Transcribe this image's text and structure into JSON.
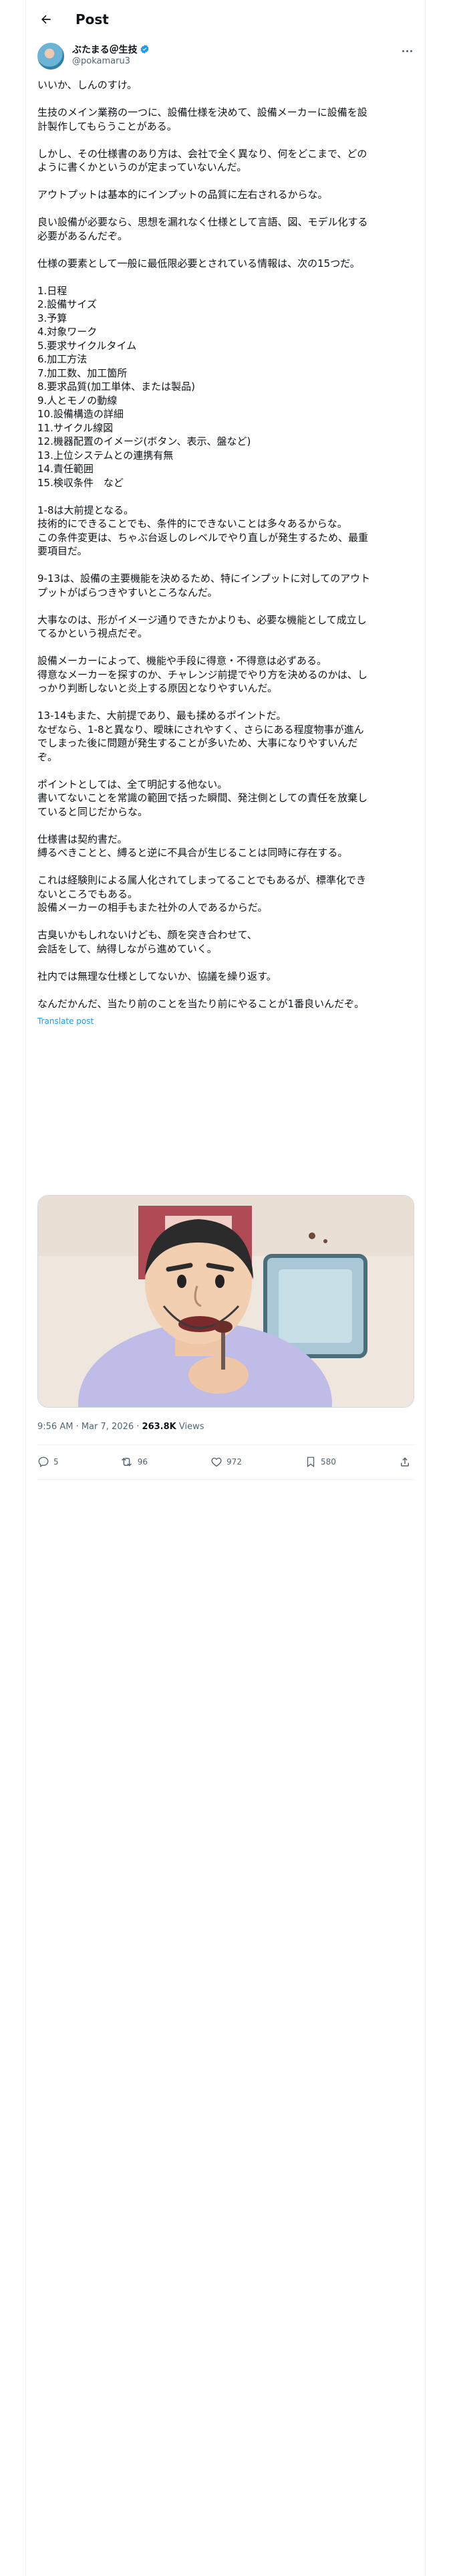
{
  "header": {
    "title": "Post"
  },
  "author": {
    "name": "ぶたまる＠生技",
    "handle": "@pokamaru3"
  },
  "tweet": {
    "lines": [
      "いいか、しんのすけ。",
      "",
      "生技のメイン業務の一つに、設備仕様を決めて、設備メーカーに設備を設",
      "計製作してもらうことがある。",
      "",
      "しかし、その仕様書のあり方は、会社で全く異なり、何をどこまで、どの",
      "ように書くかというのが定まっていないんだ。",
      "",
      "アウトプットは基本的にインプットの品質に左右されるからな。",
      "",
      "良い設備が必要なら、思想を漏れなく仕様として言語、図、モデル化する",
      "必要があるんだぞ。",
      "",
      "仕様の要素として一般に最低限必要とされている情報は、次の15つだ。",
      "",
      "1.日程",
      "2.設備サイズ",
      "3.予算",
      "4.対象ワーク",
      "5.要求サイクルタイム",
      "6.加工方法",
      "7.加工数、加工箇所",
      "8.要求品質(加工単体、または製品)",
      "9.人とモノの動線",
      "10.設備構造の詳細",
      "11.サイクル線図",
      "12.機器配置のイメージ(ボタン、表示、盤など)",
      "13.上位システムとの連携有無",
      "14.責任範囲",
      "15.検収条件　など",
      "",
      "1-8は大前提となる。",
      "技術的にできることでも、条件的にできないことは多々あるからな。",
      "この条件変更は、ちゃぶ台返しのレベルでやり直しが発生するため、最重",
      "要項目だ。",
      "",
      "9-13は、設備の主要機能を決めるため、特にインプットに対してのアウト",
      "プットがばらつきやすいところなんだ。",
      "",
      "大事なのは、形がイメージ通りできたかよりも、必要な機能として成立し",
      "てるかという視点だぞ。",
      "",
      "設備メーカーによって、機能や手段に得意・不得意は必ずある。",
      "得意なメーカーを探すのか、チャレンジ前提でやり方を決めるのかは、し",
      "っかり判断しないと炎上する原因となりやすいんだ。",
      "",
      "13-14もまた、大前提であり、最も揉めるポイントだ。",
      "なぜなら、1-8と異なり、曖昧にされやすく、さらにある程度物事が進ん",
      "でしまった後に問題が発生することが多いため、大事になりやすいんだ",
      "ぞ。",
      "",
      "ポイントとしては、全て明記する他ない。",
      "書いてないことを常識の範囲で括った瞬間、発注側としての責任を放棄し",
      "ていると同じだからな。",
      "",
      "仕様書は契約書だ。",
      "縛るべきことと、縛ると逆に不具合が生じることは同時に存在する。",
      "",
      "これは経験則による属人化されてしまってることでもあるが、標準化でき",
      "ないところでもある。",
      "設備メーカーの相手もまた社外の人であるからだ。",
      "",
      "古臭いかもしれないけども、顔を突き合わせて、",
      "会話をして、納得しながら進めていく。",
      "",
      "社内では無理な仕様としてないか、協議を繰り返す。",
      "",
      "なんだかんだ、当たり前のことを当たり前にやることが1番良いんだぞ。"
    ],
    "translate_label": "Translate post",
    "meta": {
      "time": "9:56 AM · Mar 7, 2026",
      "separator": " · ",
      "views_count": "263.8K",
      "views_label": " Views"
    }
  },
  "actions": {
    "replies": "5",
    "reposts": "96",
    "likes": "972",
    "bookmarks": "580"
  },
  "colors": {
    "accent": "#1d9bf0",
    "muted": "#536471",
    "text": "#0f1419",
    "border": "#eff3f4"
  }
}
